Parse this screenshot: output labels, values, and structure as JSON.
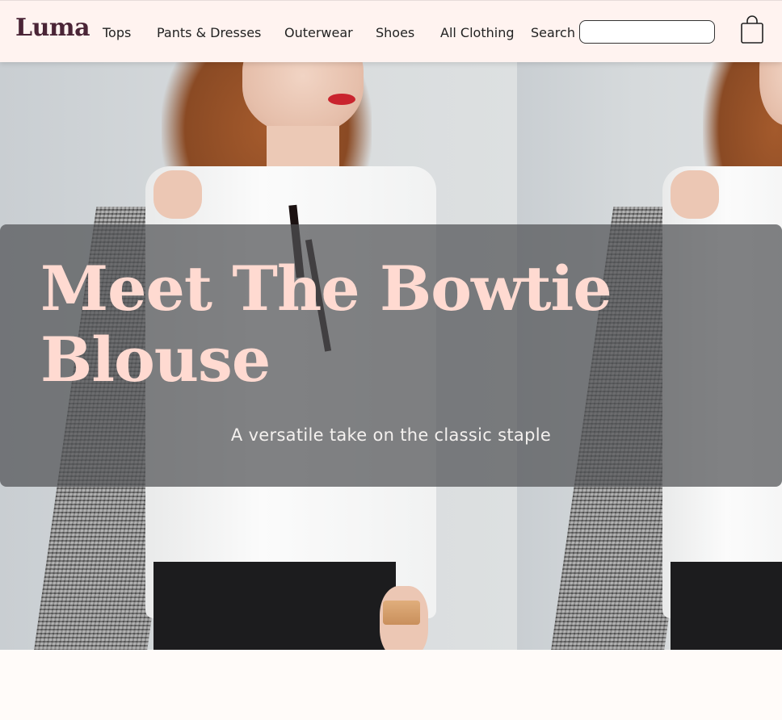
{
  "brand": {
    "logo": "Luma"
  },
  "nav": {
    "items": [
      {
        "label": "Tops"
      },
      {
        "label": "Pants & Dresses"
      },
      {
        "label": "Outerwear"
      },
      {
        "label": "Shoes"
      },
      {
        "label": "All Clothing"
      }
    ],
    "search_label": "Search",
    "search_placeholder": "",
    "cart_icon": "shopping-bag-icon"
  },
  "hero": {
    "title": "Meet The Bowtie Blouse",
    "subtitle": "A versatile take on the classic staple",
    "image": "model-in-white-bowtie-blouse-photo"
  },
  "colors": {
    "header_bg": "#fff3f0",
    "logo": "#4a2436",
    "title": "#ffdad1"
  }
}
